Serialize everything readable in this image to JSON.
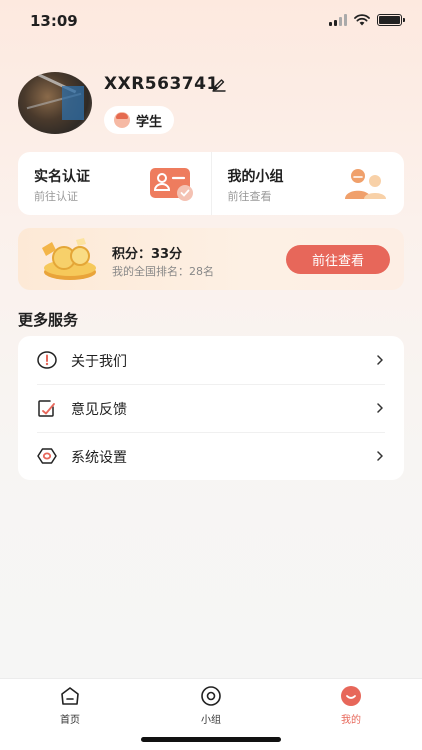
{
  "status_bar": {
    "time": "13:09",
    "battery_level": 1.0
  },
  "profile": {
    "username": "XXR563741",
    "role": "学生"
  },
  "quick_actions": [
    {
      "title": "实名认证",
      "subtitle": "前往认证",
      "icon": "id-card-icon"
    },
    {
      "title": "我的小组",
      "subtitle": "前往查看",
      "icon": "group-icon"
    }
  ],
  "points": {
    "title": "积分：33分",
    "rank": "我的全国排名：28名",
    "button": "前往查看"
  },
  "services": {
    "title": "更多服务",
    "items": [
      {
        "label": "关于我们",
        "icon": "info-icon"
      },
      {
        "label": "意见反馈",
        "icon": "feedback-icon"
      },
      {
        "label": "系统设置",
        "icon": "settings-icon"
      }
    ]
  },
  "tab_bar": {
    "tabs": [
      {
        "label": "首页",
        "icon": "home-icon"
      },
      {
        "label": "小组",
        "icon": "eye-icon"
      },
      {
        "label": "我的",
        "icon": "profile-icon"
      }
    ],
    "active": "我的",
    "active_color": "#e7675a"
  },
  "colors": {
    "accent": "#e7675a",
    "background_top": "#fde9df"
  }
}
